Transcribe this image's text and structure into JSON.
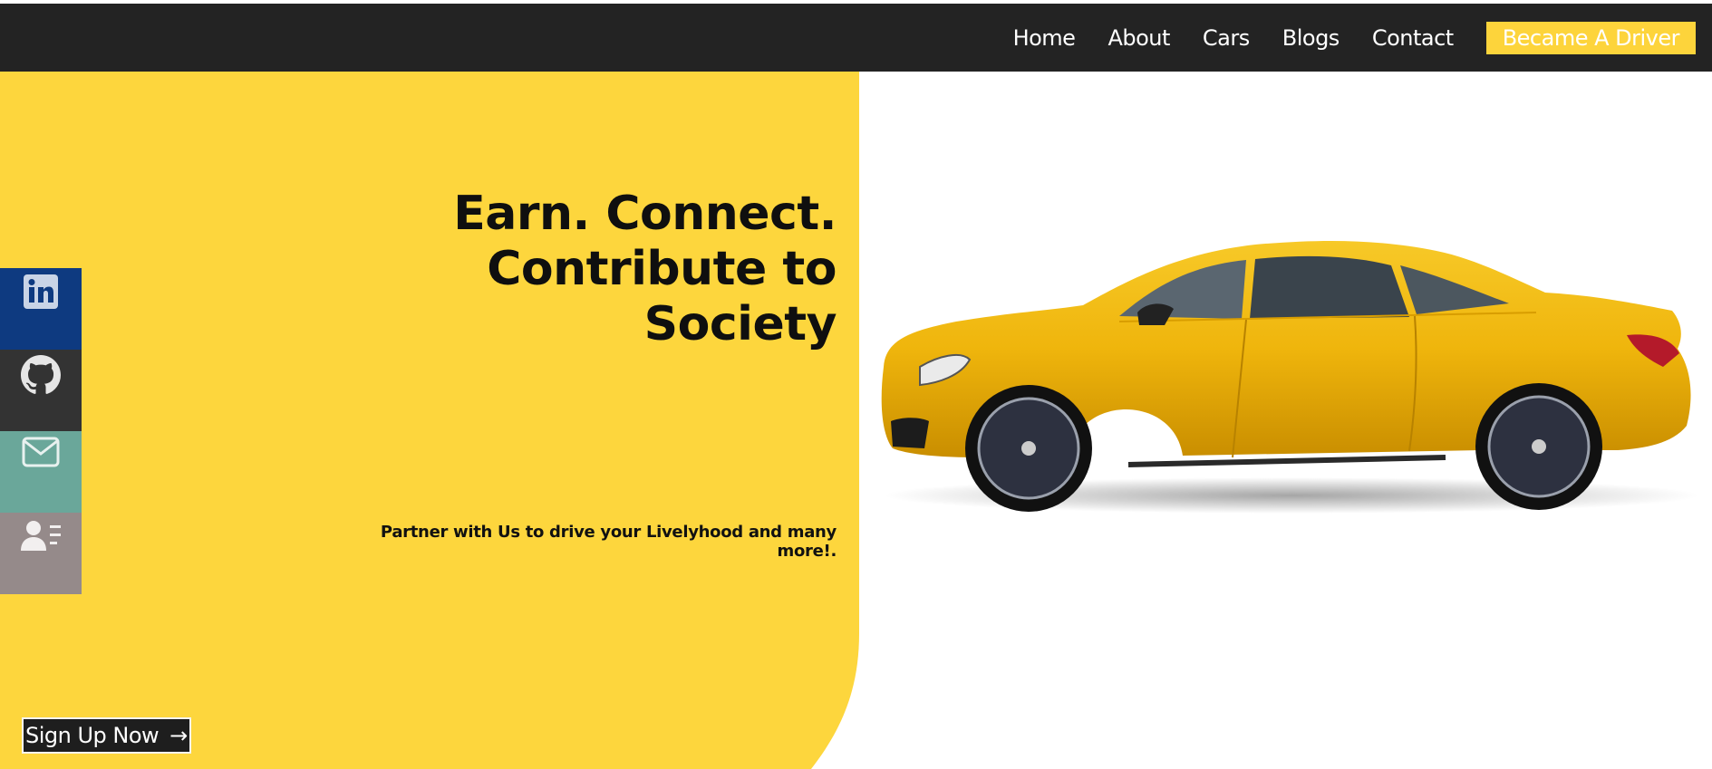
{
  "nav": {
    "links": [
      "Home",
      "About",
      "Cars",
      "Blogs",
      "Contact"
    ],
    "cta": "Became A Driver"
  },
  "hero": {
    "title_lines": [
      "Earn. Connect.",
      "Contribute to",
      "Society"
    ],
    "subtitle": "Partner with Us to drive your Livelyhood and many more!.",
    "signup_label": "Sign Up Now",
    "signup_arrow": "→"
  },
  "social": [
    {
      "icon": "linkedin-icon",
      "color": "#0e3a80"
    },
    {
      "icon": "github-icon",
      "color": "#333333"
    },
    {
      "icon": "mail-icon",
      "color": "#6aa79a"
    },
    {
      "icon": "contact-card-icon",
      "color": "#958a8a"
    }
  ],
  "colors": {
    "accent": "#fdd63d",
    "navbar": "#232323",
    "car": "#f2b90e"
  }
}
